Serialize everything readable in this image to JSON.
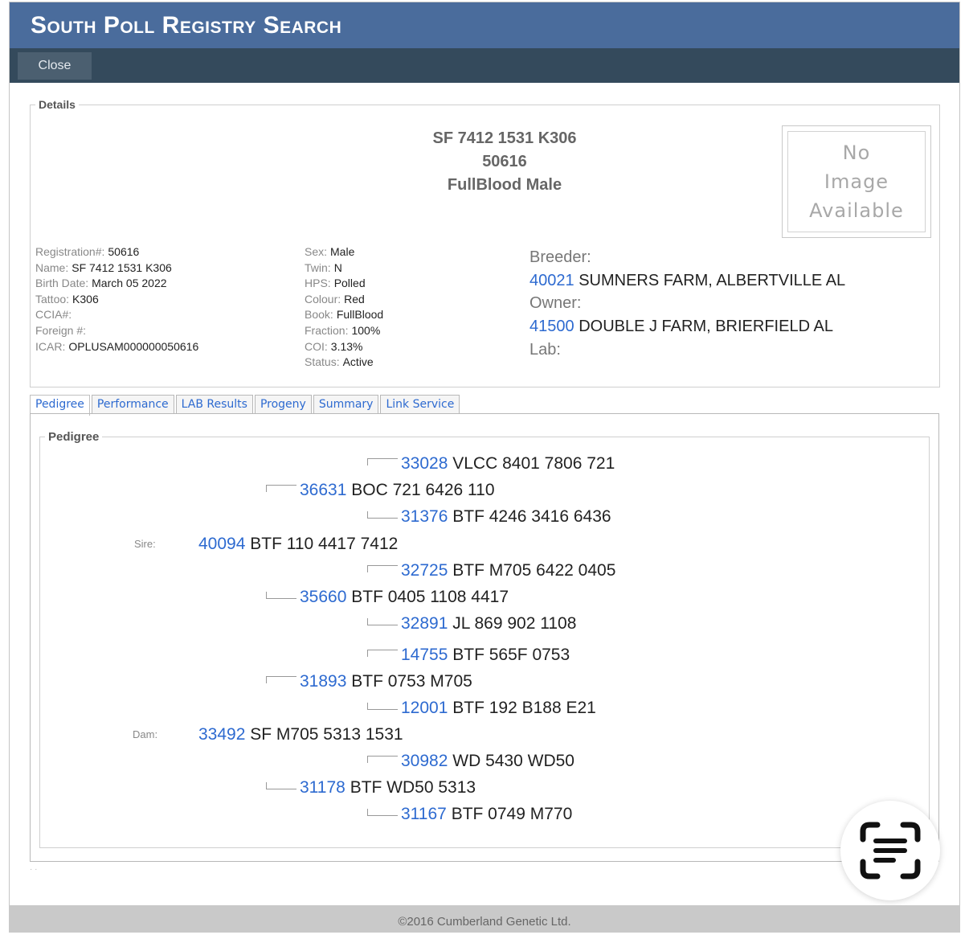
{
  "window": {
    "title": "South Poll Registry Search",
    "close_label": "Close"
  },
  "details": {
    "legend": "Details",
    "heading": [
      "SF 7412 1531 K306",
      "50616",
      "FullBlood Male"
    ],
    "no_image": [
      "No",
      "Image",
      "Available"
    ],
    "col1": [
      {
        "label": "Registration#:",
        "value": "50616"
      },
      {
        "label": "Name:",
        "value": "SF 7412 1531 K306"
      },
      {
        "label": "Birth Date:",
        "value": "March 05 2022"
      },
      {
        "label": "Tattoo:",
        "value": "K306"
      },
      {
        "label": "CCIA#:",
        "value": ""
      },
      {
        "label": "Foreign #:",
        "value": ""
      },
      {
        "label": "ICAR:",
        "value": "OPLUSAM000000050616"
      }
    ],
    "col2": [
      {
        "label": "Sex:",
        "value": "Male"
      },
      {
        "label": "Twin:",
        "value": "N"
      },
      {
        "label": "HPS:",
        "value": "Polled"
      },
      {
        "label": "Colour:",
        "value": "Red"
      },
      {
        "label": "Book:",
        "value": "FullBlood"
      },
      {
        "label": "Fraction:",
        "value": "100%"
      },
      {
        "label": "COI:",
        "value": "3.13%"
      },
      {
        "label": "Status:",
        "value": "Active"
      }
    ],
    "breeder_label": "Breeder:",
    "breeder_id": "40021",
    "breeder_name": "SUMNERS FARM, ALBERTVILLE AL",
    "owner_label": "Owner:",
    "owner_id": "41500",
    "owner_name": "DOUBLE J FARM, BRIERFIELD AL",
    "lab_label": "Lab:"
  },
  "tabs": [
    "Pedigree",
    "Performance",
    "LAB Results",
    "Progeny",
    "Summary",
    "Link Service"
  ],
  "pedigree": {
    "legend": "Pedigree",
    "sire_label": "Sire:",
    "dam_label": "Dam:",
    "rows": [
      {
        "id": "33028",
        "name": "VLCC 8401 7806 721"
      },
      {
        "id": "36631",
        "name": "BOC 721 6426 110"
      },
      {
        "id": "31376",
        "name": "BTF 4246 3416 6436"
      },
      {
        "id": "40094",
        "name": "BTF 110 4417 7412"
      },
      {
        "id": "32725",
        "name": "BTF M705 6422 0405"
      },
      {
        "id": "35660",
        "name": "BTF 0405 1108 4417"
      },
      {
        "id": "32891",
        "name": "JL 869 902 1108"
      },
      {
        "id": "14755",
        "name": "BTF 565F 0753"
      },
      {
        "id": "31893",
        "name": "BTF 0753 M705"
      },
      {
        "id": "12001",
        "name": "BTF 192 B188 E21"
      },
      {
        "id": "33492",
        "name": "SF M705 5313 1531"
      },
      {
        "id": "30982",
        "name": "WD 5430 WD50"
      },
      {
        "id": "31178",
        "name": "BTF WD50 5313"
      },
      {
        "id": "31167",
        "name": "BTF 0749 M770"
      }
    ]
  },
  "footer": "©2016 Cumberland Genetic Ltd."
}
